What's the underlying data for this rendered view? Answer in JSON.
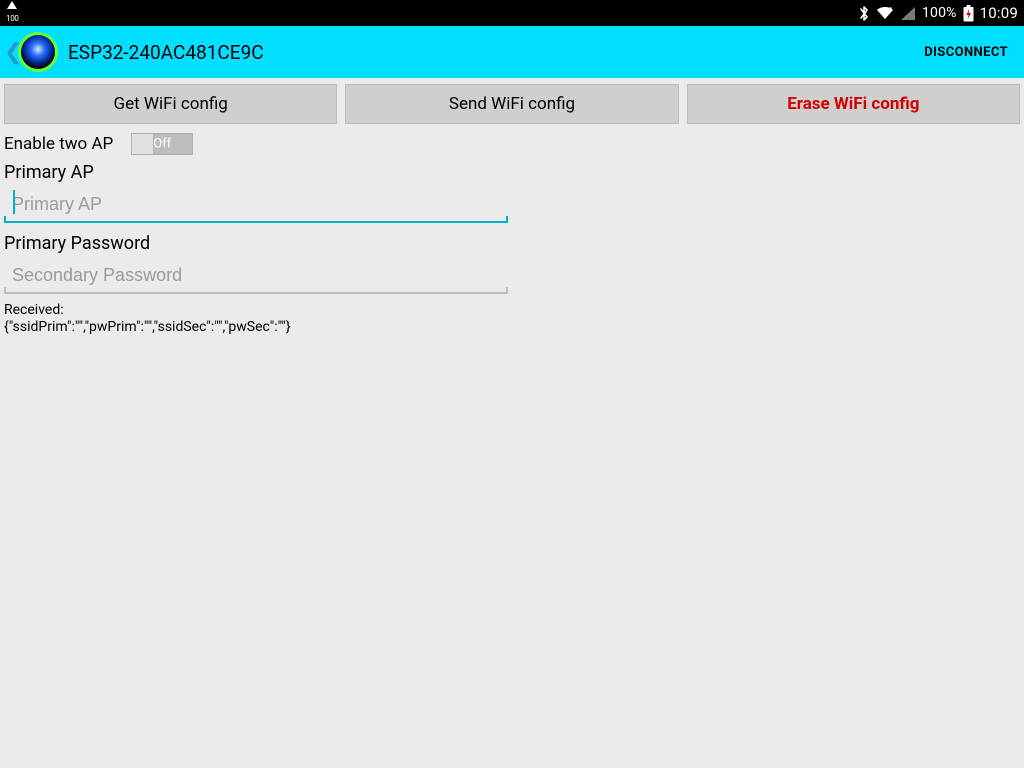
{
  "statusbar": {
    "scale_label": "100",
    "battery_pct": "100%",
    "clock": "10:09"
  },
  "appbar": {
    "title": "ESP32-240AC481CE9C",
    "disconnect_label": "DISCONNECT"
  },
  "buttons": {
    "get_wifi": "Get WiFi config",
    "send_wifi": "Send WiFi config",
    "erase_wifi": "Erase WiFi config"
  },
  "form": {
    "enable_two_ap_label": "Enable two AP",
    "enable_two_ap_value": "Off",
    "primary_ap_label": "Primary AP",
    "primary_ap_placeholder": "Primary AP",
    "primary_ap_value": "",
    "primary_pw_label": "Primary Password",
    "primary_pw_placeholder": "Secondary Password",
    "primary_pw_value": ""
  },
  "received": {
    "label": "Received:",
    "content": "{\"ssidPrim\":\"\",\"pwPrim\":\"\",\"ssidSec\":\"\",\"pwSec\":\"\"}"
  }
}
